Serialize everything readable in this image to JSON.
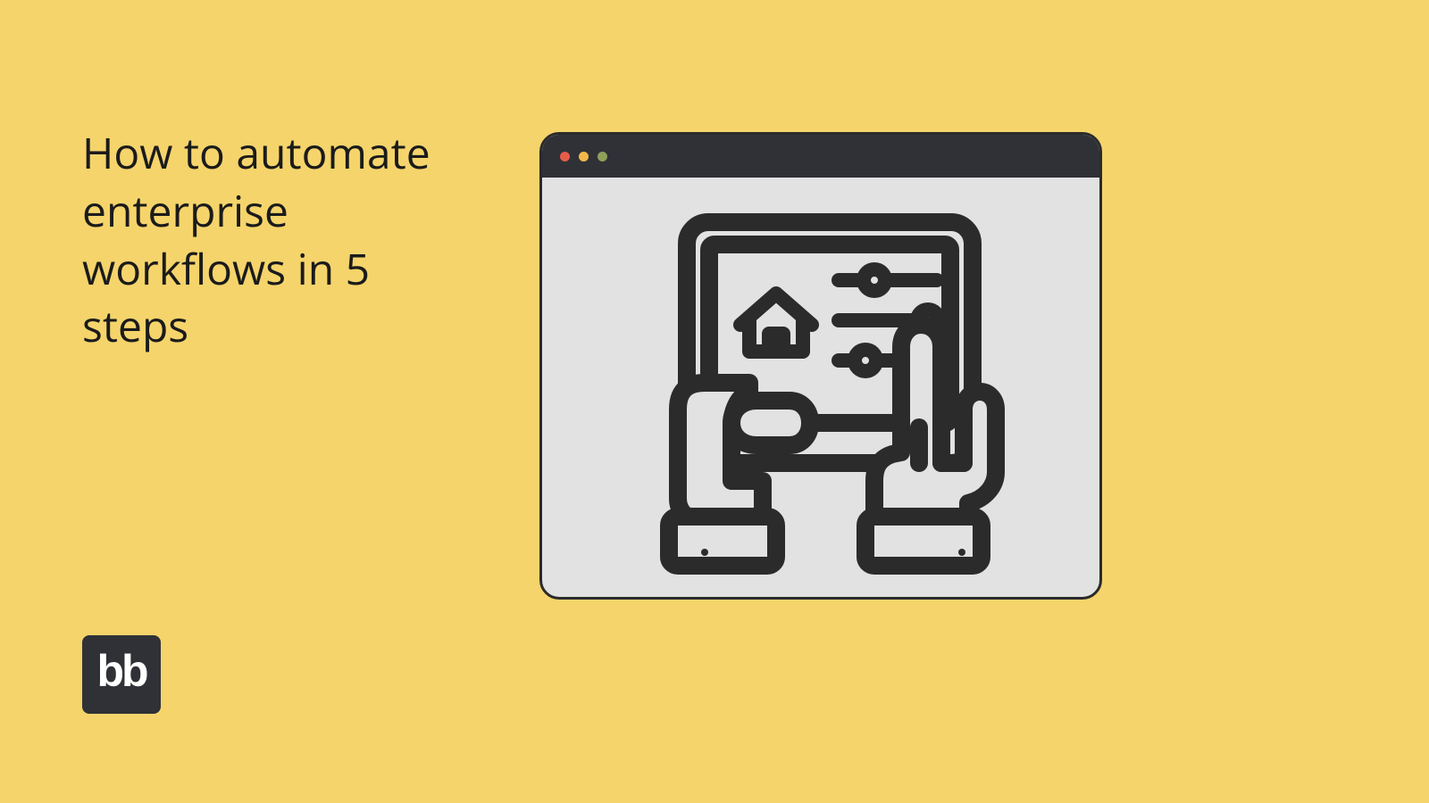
{
  "headline": "How to automate enterprise workflows in 5 steps",
  "logo": {
    "text": "bb"
  },
  "window": {
    "dots": [
      "#e85c4a",
      "#f2b94a",
      "#8fa05a"
    ],
    "illustration": "tablet-settings-hands-icon"
  },
  "colors": {
    "background": "#f5d46b",
    "windowFrame": "#2f3136",
    "windowBody": "#e2e2e2",
    "stroke": "#2b2b2b"
  }
}
